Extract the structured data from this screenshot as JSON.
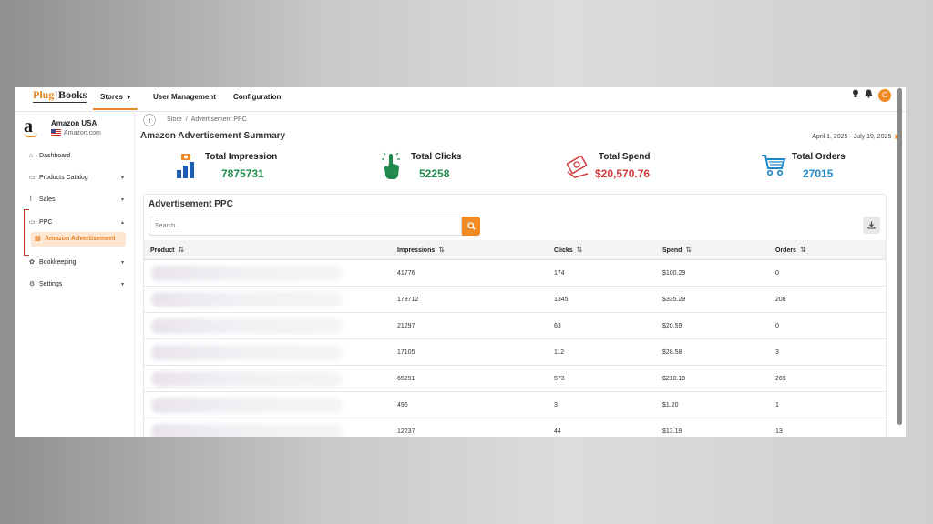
{
  "app": {
    "logo_plug": "Plug",
    "logo_books": "Books"
  },
  "topnav": {
    "stores": "Stores",
    "user_management": "User Management",
    "configuration": "Configuration",
    "avatar_initial": "C"
  },
  "store": {
    "name": "Amazon USA",
    "domain": "Amazon.com",
    "logo": "a"
  },
  "sidebar": {
    "dashboard": "Dashboard",
    "products_catalog": "Products Catalog",
    "sales": "Sales",
    "ppc": "PPC",
    "amazon_advertisement": "Amazon Advertisement",
    "bookkeeping": "Bookkeeping",
    "settings": "Settings"
  },
  "breadcrumb": {
    "store": "Store",
    "separator": "/",
    "current": "Advertisement PPC"
  },
  "page": {
    "title": "Amazon Advertisement Summary",
    "date_range": "April 1, 2025 - July 19, 2025"
  },
  "stats": {
    "impression": {
      "label": "Total Impression",
      "value": "7875731",
      "color": "#1f8a4c"
    },
    "clicks": {
      "label": "Total Clicks",
      "value": "52258",
      "color": "#1f8a4c"
    },
    "spend": {
      "label": "Total Spend",
      "value": "$20,570.76",
      "color": "#d23b3b"
    },
    "orders": {
      "label": "Total Orders",
      "value": "27015",
      "color": "#1e88c8"
    }
  },
  "table": {
    "title": "Advertisement PPC",
    "search_placeholder": "Search...",
    "columns": {
      "product": "Product",
      "impressions": "Impressions",
      "clicks": "Clicks",
      "spend": "Spend",
      "orders": "Orders"
    },
    "rows": [
      {
        "impressions": "41776",
        "clicks": "174",
        "spend": "$100.29",
        "orders": "0"
      },
      {
        "impressions": "179712",
        "clicks": "1345",
        "spend": "$335.29",
        "orders": "208"
      },
      {
        "impressions": "21297",
        "clicks": "63",
        "spend": "$20.59",
        "orders": "0"
      },
      {
        "impressions": "17105",
        "clicks": "112",
        "spend": "$28.58",
        "orders": "3"
      },
      {
        "impressions": "65291",
        "clicks": "573",
        "spend": "$210.19",
        "orders": "269"
      },
      {
        "impressions": "496",
        "clicks": "3",
        "spend": "$1.20",
        "orders": "1"
      },
      {
        "impressions": "12237",
        "clicks": "44",
        "spend": "$13.19",
        "orders": "13"
      }
    ]
  },
  "colors": {
    "accent": "#f08a24",
    "ppc_highlight": "#c0392b"
  }
}
